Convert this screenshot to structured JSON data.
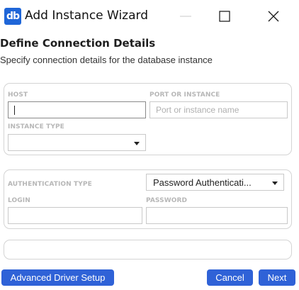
{
  "window": {
    "app_icon_text": "db",
    "title": "Add Instance Wizard"
  },
  "header": {
    "title": "Define Connection Details",
    "subtitle": "Specify connection details for the database instance"
  },
  "connection": {
    "host_label": "HOST",
    "host_value": "",
    "port_label": "PORT OR INSTANCE",
    "port_placeholder": "Port or instance name",
    "instance_type_label": "INSTANCE TYPE",
    "instance_type_value": ""
  },
  "authentication": {
    "type_label": "AUTHENTICATION TYPE",
    "type_value": "Password Authenticati...",
    "login_label": "LOGIN",
    "login_value": "",
    "password_label": "PASSWORD",
    "password_value": ""
  },
  "footer": {
    "advanced_label": "Advanced Driver Setup",
    "cancel_label": "Cancel",
    "next_label": "Next"
  },
  "colors": {
    "accent": "#2f62d7",
    "app_icon": "#1f66d8",
    "label": "#b7b7b7",
    "border": "#d4d4d4"
  },
  "icons": [
    "database-app-icon",
    "minimize-icon",
    "maximize-icon",
    "close-icon",
    "dropdown-arrow-icon"
  ]
}
